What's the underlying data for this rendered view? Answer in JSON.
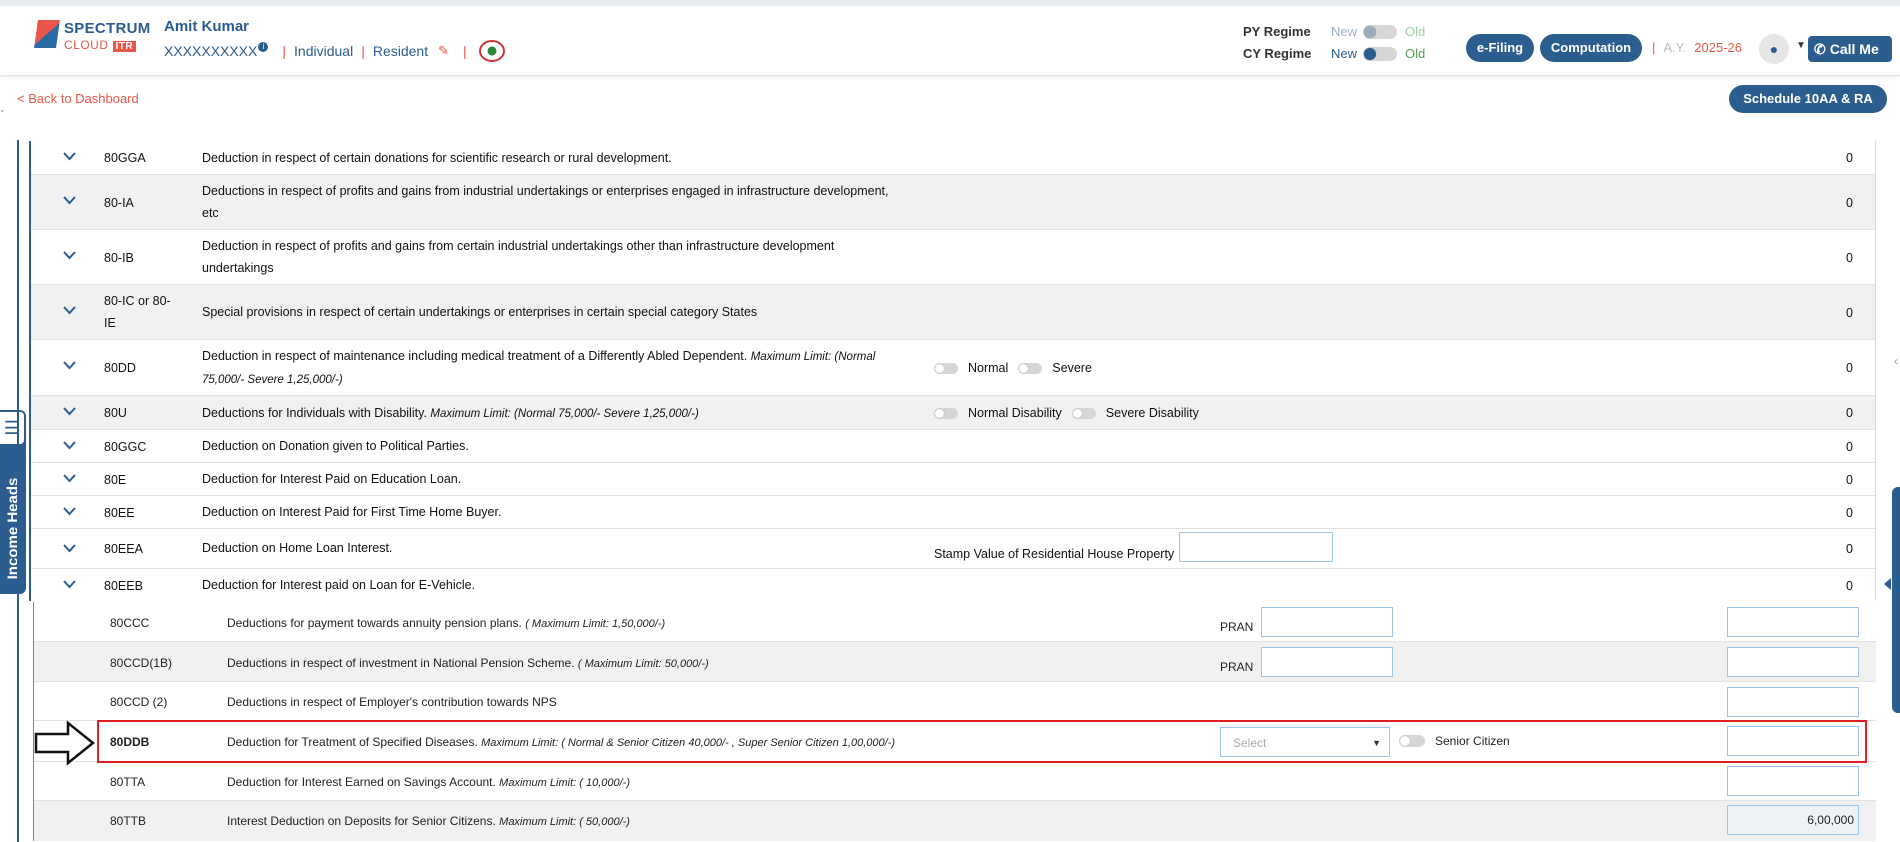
{
  "header": {
    "logo_line1": "SPECTRUM",
    "logo_line2": "CLOUD",
    "logo_badge": "ITR",
    "user_name": "Amit Kumar",
    "pan": "XXXXXXXXXX",
    "status": "Individual",
    "residency": "Resident",
    "py_regime_label": "PY Regime",
    "cy_regime_label": "CY Regime",
    "new_label": "New",
    "old_label": "Old",
    "efiling_label": "e-Filing",
    "computation_label": "Computation",
    "ay_label": "A.Y.",
    "ay_value": "2025-26",
    "call_label": "Call Me"
  },
  "subbar": {
    "back_label": "< Back to Dashboard",
    "schedule_label": "Schedule 10AA & RA"
  },
  "side_tab": {
    "label": "Income Heads"
  },
  "rows": [
    {
      "code": "80GGA",
      "desc": "Deduction in respect of certain donations for scientific research or rural development.",
      "value": "0"
    },
    {
      "code": "80-IA",
      "desc_line1": "Deductions in respect of profits and gains from industrial undertakings or enterprises engaged in infrastructure development,",
      "desc_line2": "etc",
      "value": "0"
    },
    {
      "code": "80-IB",
      "desc_line1": "Deduction in respect of profits and gains from certain industrial undertakings other than infrastructure development",
      "desc_line2": "undertakings",
      "value": "0"
    },
    {
      "code_line1": "80-IC or 80-",
      "code_line2": "IE",
      "desc": "Special provisions in respect of certain undertakings or enterprises in certain special category States",
      "value": "0"
    },
    {
      "code": "80DD",
      "desc_line1": "Deduction in respect of maintenance including medical treatment of a Differently Abled Dependent.",
      "limit_line1": "Maximum Limit: (Normal",
      "limit_line2": "75,000/- Severe 1,25,000/-)",
      "opt1": "Normal",
      "opt2": "Severe",
      "value": "0"
    },
    {
      "code": "80U",
      "desc": "Deductions for Individuals with Disability.",
      "limit": "Maximum Limit: (Normal 75,000/- Severe 1,25,000/-)",
      "opt1": "Normal Disability",
      "opt2": "Severe Disability",
      "value": "0"
    },
    {
      "code": "80GGC",
      "desc": "Deduction on Donation given to Political Parties.",
      "value": "0"
    },
    {
      "code": "80E",
      "desc": "Deduction for Interest Paid on Education Loan.",
      "value": "0"
    },
    {
      "code": "80EE",
      "desc": "Deduction on Interest Paid for First Time Home Buyer.",
      "value": "0"
    },
    {
      "code": "80EEA",
      "desc": "Deduction on Home Loan Interest.",
      "stamp_label": "Stamp Value of Residential House Property",
      "value": "0"
    },
    {
      "code": "80EEB",
      "desc": "Deduction for Interest paid on Loan for E-Vehicle.",
      "value": "0"
    }
  ],
  "subrows": [
    {
      "code": "80CCC",
      "desc": "Deductions for payment towards annuity pension plans.",
      "limit": "( Maximum Limit: 1,50,000/-)",
      "pran_label": "PRAN",
      "amount": ""
    },
    {
      "code": "80CCD(1B)",
      "desc": "Deductions in respect of investment in National Pension Scheme.",
      "limit": "( Maximum Limit: 50,000/-)",
      "pran_label": "PRAN",
      "amount": ""
    },
    {
      "code": "80CCD (2)",
      "desc": "Deductions in respect of Employer's contribution towards NPS",
      "amount": ""
    },
    {
      "code": "80DDB",
      "desc": "Deduction for Treatment of Specified Diseases.",
      "limit": "Maximum Limit: ( Normal & Senior Citizen 40,000/- , Super Senior Citizen 1,00,000/-)",
      "select_placeholder": "Select",
      "senior_label": "Senior Citizen",
      "amount": ""
    },
    {
      "code": "80TTA",
      "desc": "Deduction for Interest Earned on Savings Account.",
      "limit": "Maximum Limit: ( 10,000/-)",
      "amount": ""
    },
    {
      "code": "80TTB",
      "desc": "Interest Deduction on Deposits for Senior Citizens.",
      "limit": "Maximum Limit: ( 50,000/-)",
      "amount": "6,00,000"
    }
  ],
  "colors": {
    "brand": "#2c5d8f",
    "accent": "#e8564a",
    "highlight": "#e02020"
  }
}
